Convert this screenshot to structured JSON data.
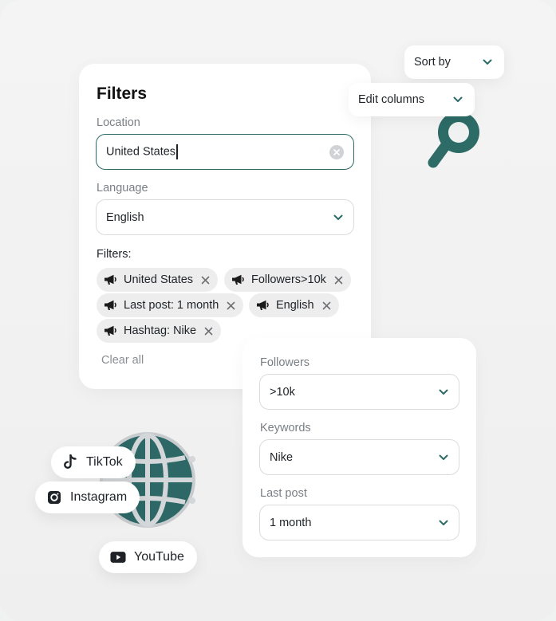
{
  "filters_panel": {
    "title": "Filters",
    "location_label": "Location",
    "location_value": "United States",
    "language_label": "Language",
    "language_value": "English",
    "active_label": "Filters:",
    "chips": [
      "United States",
      "Followers>10k",
      "Last post: 1 month",
      "English",
      "Hashtag: Nike"
    ],
    "clear_all": "Clear all"
  },
  "sort_menu": {
    "label": "Sort by"
  },
  "columns_menu": {
    "label": "Edit columns"
  },
  "extra_filters": {
    "followers_label": "Followers",
    "followers_value": ">10k",
    "keywords_label": "Keywords",
    "keywords_value": "Nike",
    "last_post_label": "Last post",
    "last_post_value": "1 month"
  },
  "platforms": [
    "TikTok",
    "Instagram",
    "YouTube"
  ],
  "colors": {
    "accent": "#2d6b67",
    "chip_bg": "#ededed",
    "card_bg": "#ffffff"
  },
  "icons": [
    "megaphone-icon",
    "close-icon",
    "clear-icon",
    "chevron-down-icon",
    "tiktok-icon",
    "instagram-icon",
    "youtube-icon",
    "search-icon",
    "globe-icon"
  ]
}
